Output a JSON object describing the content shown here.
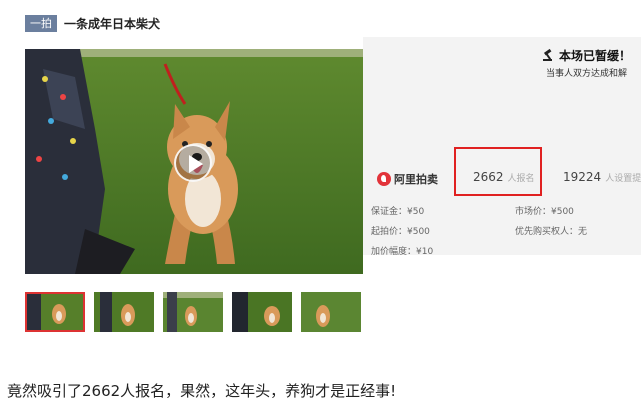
{
  "header": {
    "badge": "一拍",
    "title": "一条成年日本柴犬"
  },
  "video": {
    "play_icon": "play-icon"
  },
  "thumbnails": [
    {
      "alt": "thumbnail-1",
      "active": true
    },
    {
      "alt": "thumbnail-2",
      "active": false
    },
    {
      "alt": "thumbnail-3",
      "active": false
    },
    {
      "alt": "thumbnail-4",
      "active": false
    },
    {
      "alt": "thumbnail-5",
      "active": false
    }
  ],
  "auction": {
    "closed_title": "本场已暂缓！",
    "closed_sub": "当事人双方达成和解",
    "platform": "阿里拍卖",
    "signups": "2662",
    "signups_label": "人报名",
    "reminders": "19224",
    "reminders_label": "人设置提醒",
    "deposit": "保证金：¥50",
    "start_price": "起拍价：¥500",
    "increment": "加价幅度：¥10",
    "market_price": "市场价：¥500",
    "priority": "优先购买权人：无"
  },
  "caption": "竟然吸引了2662人报名，果然，这年头，养狗才是正经事!",
  "colors": {
    "badge": "#6b7f9e",
    "highlight": "#e02020",
    "logo": "#e2333a"
  }
}
